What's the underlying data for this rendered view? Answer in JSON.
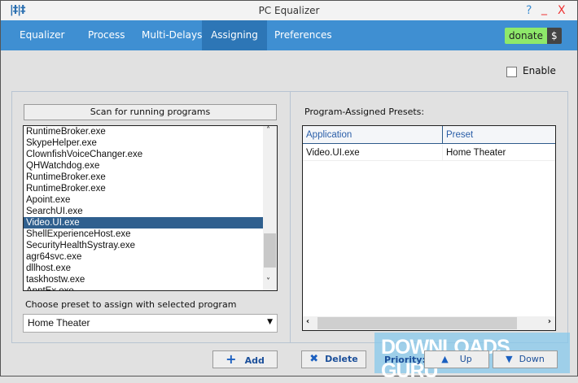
{
  "window": {
    "title": "PC Equalizer",
    "help": "?",
    "minimize": "_",
    "close": "X"
  },
  "nav": {
    "tabs": [
      {
        "label": "Equalizer"
      },
      {
        "label": "Process"
      },
      {
        "label": "Multi-Delays"
      },
      {
        "label": "Assigning",
        "active": true
      },
      {
        "label": "Preferences"
      }
    ],
    "donate": "donate",
    "donate_symbol": "$"
  },
  "enable": {
    "label": "Enable",
    "checked": false
  },
  "left": {
    "scan_button": "Scan for running programs",
    "programs": [
      "RuntimeBroker.exe",
      "SkypeHelper.exe",
      "ClownfishVoiceChanger.exe",
      "QHWatchdog.exe",
      "RuntimeBroker.exe",
      "RuntimeBroker.exe",
      "Apoint.exe",
      "SearchUI.exe",
      "Video.UI.exe",
      "ShellExperienceHost.exe",
      "SecurityHealthSystray.exe",
      "agr64svc.exe",
      "dllhost.exe",
      "taskhostw.exe",
      "ApntEx.exe"
    ],
    "selected_index": 8,
    "preset_label": "Choose preset to assign with selected program",
    "preset_value": "Home Theater"
  },
  "right": {
    "label": "Program-Assigned Presets:",
    "columns": [
      "Application",
      "Preset"
    ],
    "rows": [
      [
        "Video.UI.exe",
        "Home Theater"
      ]
    ]
  },
  "bottom": {
    "add": "Add",
    "delete": "Delete",
    "priority": "Priority:",
    "up": "Up",
    "down": "Down"
  },
  "watermark": "DOWNLOADS GURU",
  "colors": {
    "nav": "#3f8fd2",
    "selected": "#2f5f8e",
    "donate": "#8ee86a"
  }
}
